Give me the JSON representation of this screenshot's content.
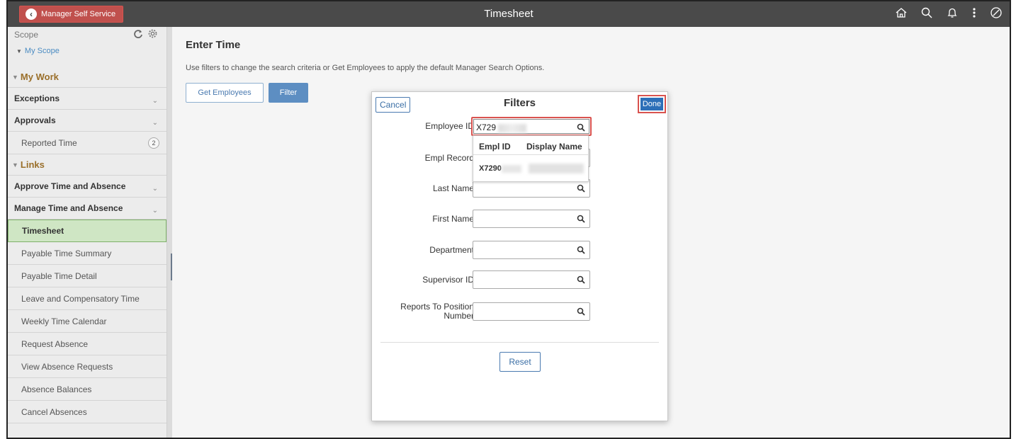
{
  "header": {
    "back_label": "Manager Self Service",
    "title": "Timesheet",
    "icons": [
      "home-icon",
      "search-icon",
      "notification-icon",
      "actions-menu-icon",
      "navbar-icon"
    ]
  },
  "sidebar": {
    "scope_label": "Scope",
    "my_scope": "My Scope",
    "my_work_heading": "My Work",
    "exceptions": "Exceptions",
    "approvals": "Approvals",
    "reported_time": "Reported Time",
    "reported_time_count": "2",
    "links_heading": "Links",
    "approve_time": "Approve Time and Absence",
    "manage_time": "Manage Time and Absence",
    "items": [
      "Timesheet",
      "Payable Time Summary",
      "Payable Time Detail",
      "Leave and Compensatory Time",
      "Weekly Time Calendar",
      "Request Absence",
      "View Absence Requests",
      "Absence Balances",
      "Cancel Absences"
    ]
  },
  "main": {
    "heading": "Enter Time",
    "instructions": "Use filters to change the search criteria or Get Employees to apply the default Manager Search Options.",
    "get_employees": "Get Employees",
    "filter": "Filter"
  },
  "modal": {
    "cancel": "Cancel",
    "title": "Filters",
    "done": "Done",
    "fields": {
      "employee_id_label": "Employee ID",
      "employee_id_value": "X729",
      "empl_record_label": "Empl Record",
      "last_name_label": "Last Name",
      "first_name_label": "First Name",
      "department_label": "Department",
      "supervisor_id_label": "Supervisor ID",
      "reports_to_label": "Reports To Position Number"
    },
    "dropdown": {
      "col1": "Empl ID",
      "col2": "Display Name",
      "row_id": "X7290"
    },
    "reset": "Reset"
  },
  "colors": {
    "header_bg": "#4a4a4a",
    "back_button": "#c0504d",
    "link_blue": "#4a8bc2",
    "done_blue": "#2d6fb8",
    "highlight_red": "#d9534f",
    "active_green": "#cfe6c4"
  }
}
